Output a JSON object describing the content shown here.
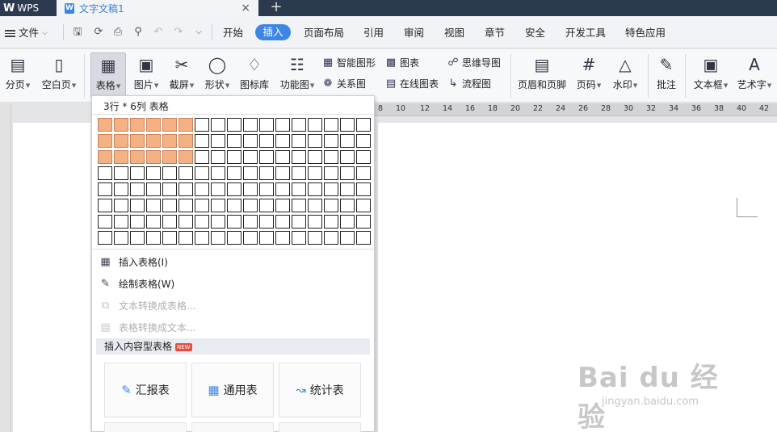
{
  "app": {
    "name": "WPS",
    "doc_tab": "文字文稿1",
    "close_glyph": "×",
    "new_tab_glyph": "+"
  },
  "menu": {
    "file": "文件",
    "tabs": [
      "开始",
      "插入",
      "页面布局",
      "引用",
      "审阅",
      "视图",
      "章节",
      "安全",
      "开发工具",
      "特色应用"
    ],
    "active_tab": "插入"
  },
  "ribbon": {
    "page_break": "分页",
    "blank_page": "空白页",
    "table": "表格",
    "picture": "图片",
    "screenshot": "截屏",
    "shape": "形状",
    "icon_library": "图标库",
    "function_chart": "功能图",
    "smart_graphic": "智能图形",
    "chart": "图表",
    "mind_map": "思维导图",
    "relation_map": "关系图",
    "online_chart": "在线图表",
    "flowchart": "流程图",
    "header_footer": "页眉和页脚",
    "page_number": "页码",
    "watermark": "水印",
    "comment": "批注",
    "text_box": "文本框",
    "word_art": "艺术字"
  },
  "ruler": {
    "ticks": [
      "8",
      "10",
      "12",
      "14",
      "16",
      "18",
      "20",
      "22",
      "24",
      "26",
      "28",
      "30",
      "32",
      "34",
      "36",
      "38",
      "40",
      "42"
    ]
  },
  "table_dropdown": {
    "grid_label": "3行 * 6列 表格",
    "selected_rows": 3,
    "selected_cols": 6,
    "total_rows": 8,
    "total_cols": 17,
    "items": [
      {
        "label": "插入表格(I)",
        "icon": "table-icon",
        "enabled": true
      },
      {
        "label": "绘制表格(W)",
        "icon": "pencil-table-icon",
        "enabled": true
      },
      {
        "label": "文本转换成表格...",
        "icon": "text-to-table-icon",
        "enabled": false
      },
      {
        "label": "表格转换成文本...",
        "icon": "table-to-text-icon",
        "enabled": false
      }
    ],
    "content_section": "插入内容型表格",
    "new_badge": "NEW",
    "cards": [
      "汇报表",
      "通用表",
      "统计表"
    ]
  },
  "watermark_text": {
    "main": "Bai du 经验",
    "sub": "jingyan.baidu.com"
  },
  "colors": {
    "accent": "#3d86e8",
    "selected_cell": "#f4b183",
    "titlebar": "#2c3a4f"
  }
}
